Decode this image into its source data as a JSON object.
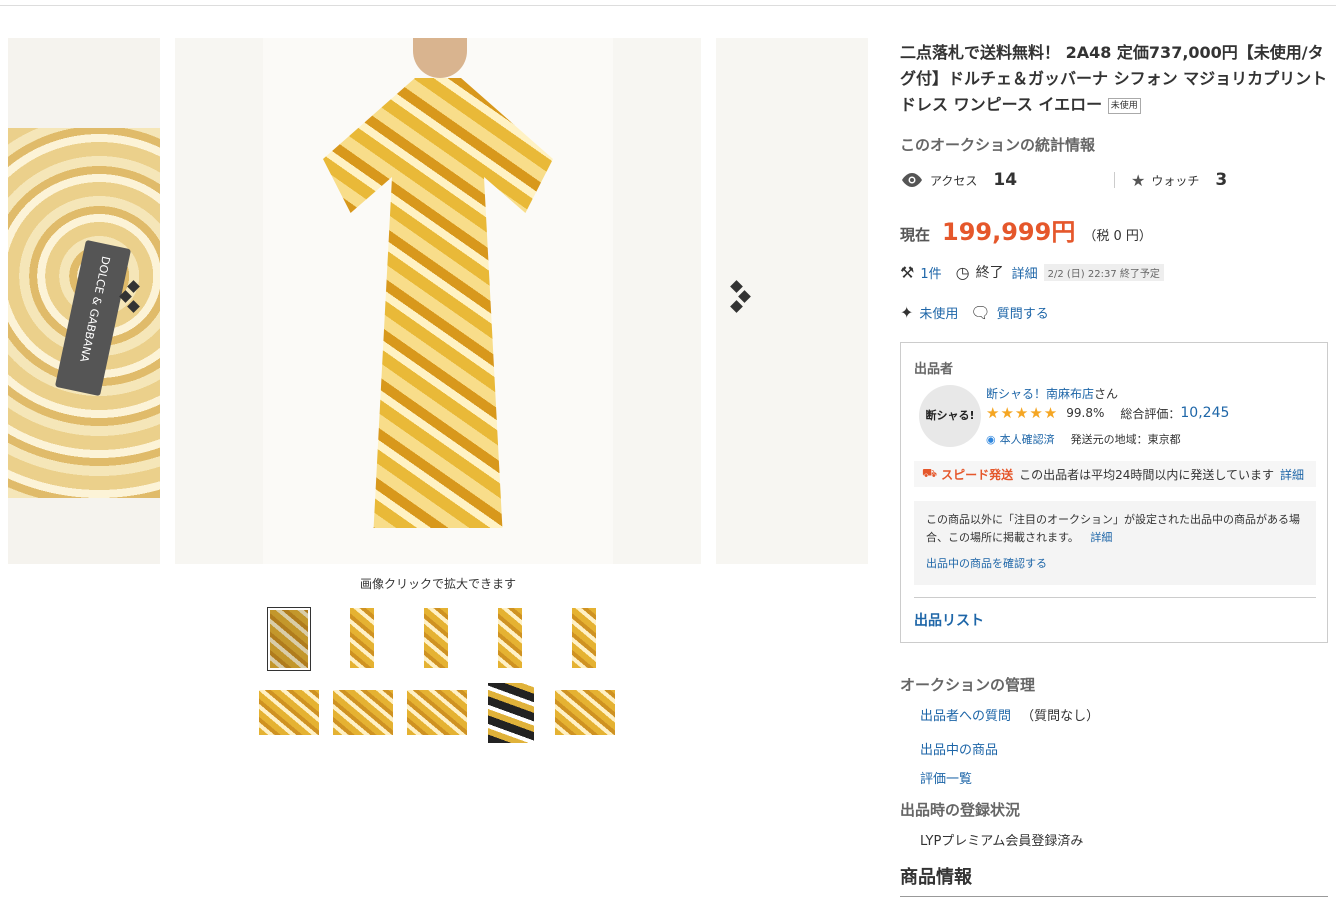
{
  "gallery": {
    "left_label": "DOLCE & GABBANA",
    "caption": "画像クリックで拡大できます"
  },
  "listing": {
    "title": "二点落札で送料無料！ 2A48 定価737,000円【未使用/タグ付】ドルチェ＆ガッバーナ シフォン マジョリカプリントドレス ワンピース イエロー",
    "condition_badge": "未使用",
    "stats_heading": "このオークションの統計情報",
    "access_label": "アクセス",
    "access_count": "14",
    "watch_label": "ウォッチ",
    "watch_count": "3",
    "price_label": "現在",
    "price": "199,999円",
    "tax": "（税 0 円）",
    "bids": "1件",
    "end_label": "終了",
    "detail_link": "詳細",
    "end_time": "2/2 (日) 22:37 終了予定",
    "condition": "未使用",
    "ask_question": "質問する"
  },
  "seller": {
    "heading": "出品者",
    "avatar_text": "断シャる!",
    "name": "断シャる！南麻布店",
    "name_suffix": "さん",
    "rating_pct": "99.8%",
    "total_label": "総合評価：",
    "total_value": "10,245",
    "verified": "本人確認済",
    "ship_from": "発送元の地域：東京都",
    "speed_label": "スピード発送",
    "speed_text": "この出品者は平均24時間以内に発送しています",
    "speed_link": "詳細",
    "notice_text": "この商品以外に「注目のオークション」が設定された出品中の商品がある場合、この場所に掲載されます。",
    "notice_link": "詳細",
    "check_link": "出品中の商品を確認する",
    "list_link": "出品リスト"
  },
  "management": {
    "heading": "オークションの管理",
    "ask_seller": "出品者への質問",
    "ask_seller_note": "（質問なし）",
    "selling": "出品中の商品",
    "reviews": "評価一覧",
    "reg_heading": "出品時の登録状況",
    "reg_value": "LYPプレミアム会員登録済み",
    "product_info": "商品情報"
  }
}
